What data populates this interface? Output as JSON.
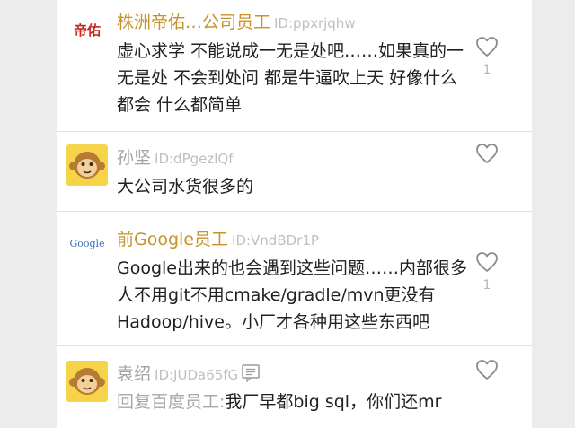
{
  "comments": [
    {
      "avatar_text": "帝佑",
      "username": "株洲帝佑…公司员工",
      "user_id": "ID:ppxrjqhw",
      "text": "虚心求学 不能说成一无是处吧……如果真的一无是处 不会到处问 都是牛逼吹上天 好像什么都会 什么都简单",
      "likes": "1"
    },
    {
      "username": "孙坚",
      "user_id": "ID:dPgezlQf",
      "text": "大公司水货很多的"
    },
    {
      "avatar_text": "Google",
      "username": "前Google员工",
      "user_id": "ID:VndBDr1P",
      "text": "Google出来的也会遇到这些问题……内部很多人不用git不用cmake/gradle/mvn更没有Hadoop/hive。小厂才各种用这些东西吧",
      "likes": "1"
    },
    {
      "username": "袁绍",
      "user_id": "ID:JUDa65fG",
      "reply_prefix": "回复百度员工:",
      "text": "我厂早都big sql，你们还mr"
    }
  ],
  "colors": {
    "name_gold": "#c8922b",
    "name_gray": "#a2a2a2",
    "id_gray": "#bfbfbf",
    "text": "#202020",
    "divider": "#e3e3e3"
  },
  "icons": {
    "like": "heart-outline-icon",
    "card": "id-card-icon",
    "avatar": "monkey-avatar-icon"
  }
}
